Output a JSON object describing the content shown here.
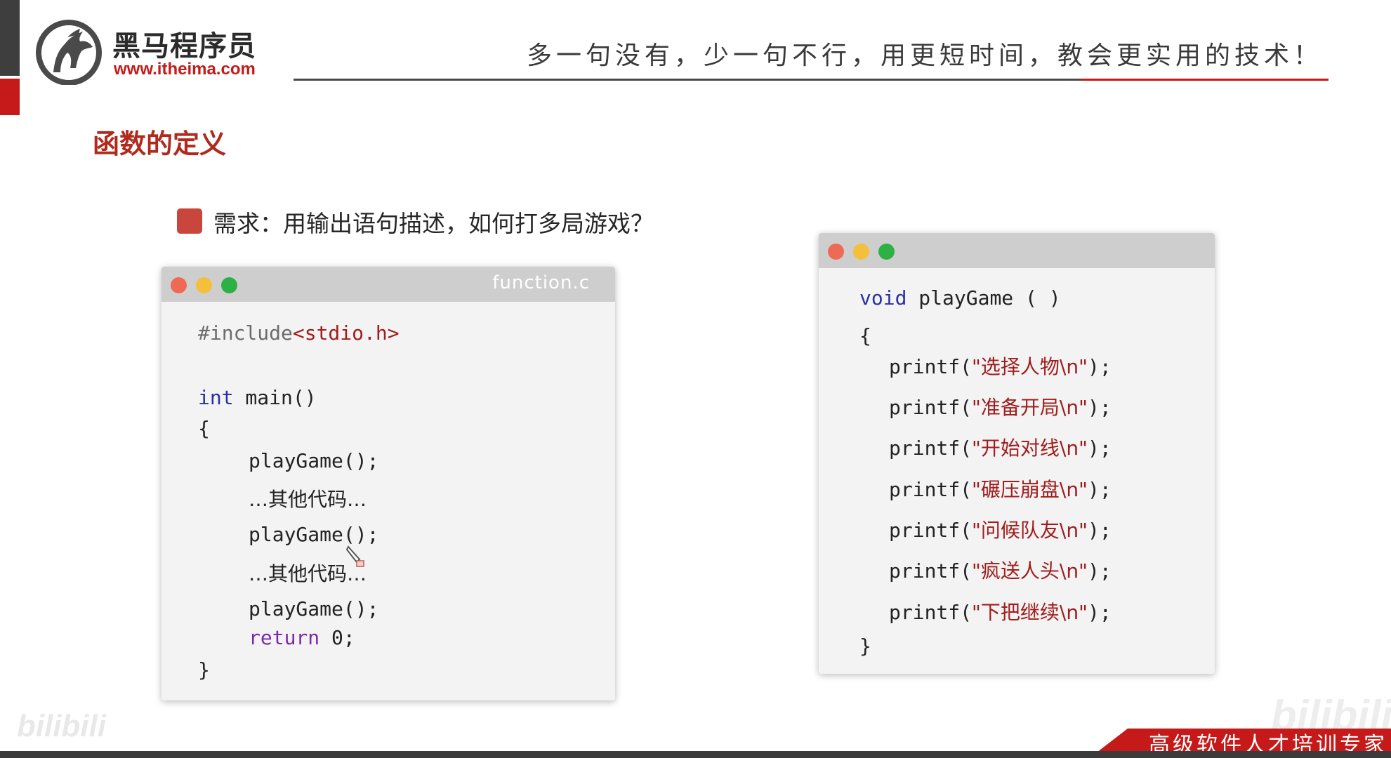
{
  "brand": {
    "name": "黑马程序员",
    "url": "www.itheima.com",
    "slogan": "多一句没有，少一句不行，用更短时间，教会更实用的技术！",
    "footer_tagline": "高级软件人才培训专家",
    "watermark": "bilibili"
  },
  "colors": {
    "brand_red": "#c61a1a",
    "title_red": "#b02a1e",
    "keyword_blue": "#2b2fa6",
    "keyword_purple": "#7b28ad",
    "string_red": "#a11d1d"
  },
  "slide": {
    "section_title": "函数的定义",
    "requirement": "需求：用输出语句描述，如何打多局游戏？"
  },
  "left_window": {
    "filename": "function.c",
    "include_directive": "#include",
    "include_header": "<stdio.h>",
    "main_type": "int",
    "main_signature": " main()",
    "open_brace": "{",
    "call_1": "playGame();",
    "other_code_1": "…其他代码…",
    "call_2": "playGame();",
    "other_code_2": "…其他代码…",
    "call_3": "playGame();",
    "return_keyword": "return",
    "return_value": " 0;",
    "close_brace": "}"
  },
  "right_window": {
    "return_type": "void",
    "function_signature": " playGame ( )",
    "open_brace": "{",
    "printf_open": "printf(",
    "printf_close": ");",
    "strings": [
      "\"选择人物\\n\"",
      "\"准备开局\\n\"",
      "\"开始对线\\n\"",
      "\"碾压崩盘\\n\"",
      "\"问候队友\\n\"",
      "\"疯送人头\\n\"",
      "\"下把继续\\n\""
    ],
    "close_brace": "}"
  },
  "icons": {
    "logo": "horse-head-logo-icon",
    "window_close": "red-dot-icon",
    "window_minimize": "yellow-dot-icon",
    "window_zoom": "green-dot-icon",
    "cursor": "pen-cursor-icon"
  }
}
